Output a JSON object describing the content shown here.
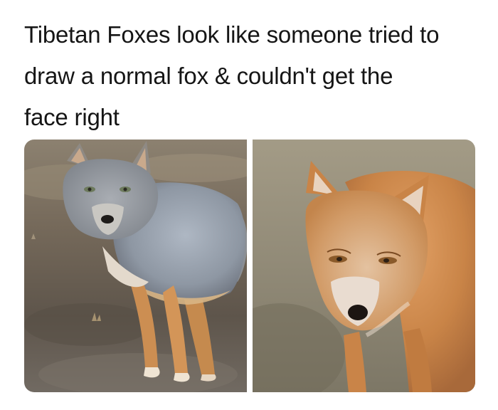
{
  "caption": {
    "line1": "Tibetan Foxes look like someone tried to",
    "line2": "draw a normal fox & couldn't get the",
    "line3": "face right"
  }
}
